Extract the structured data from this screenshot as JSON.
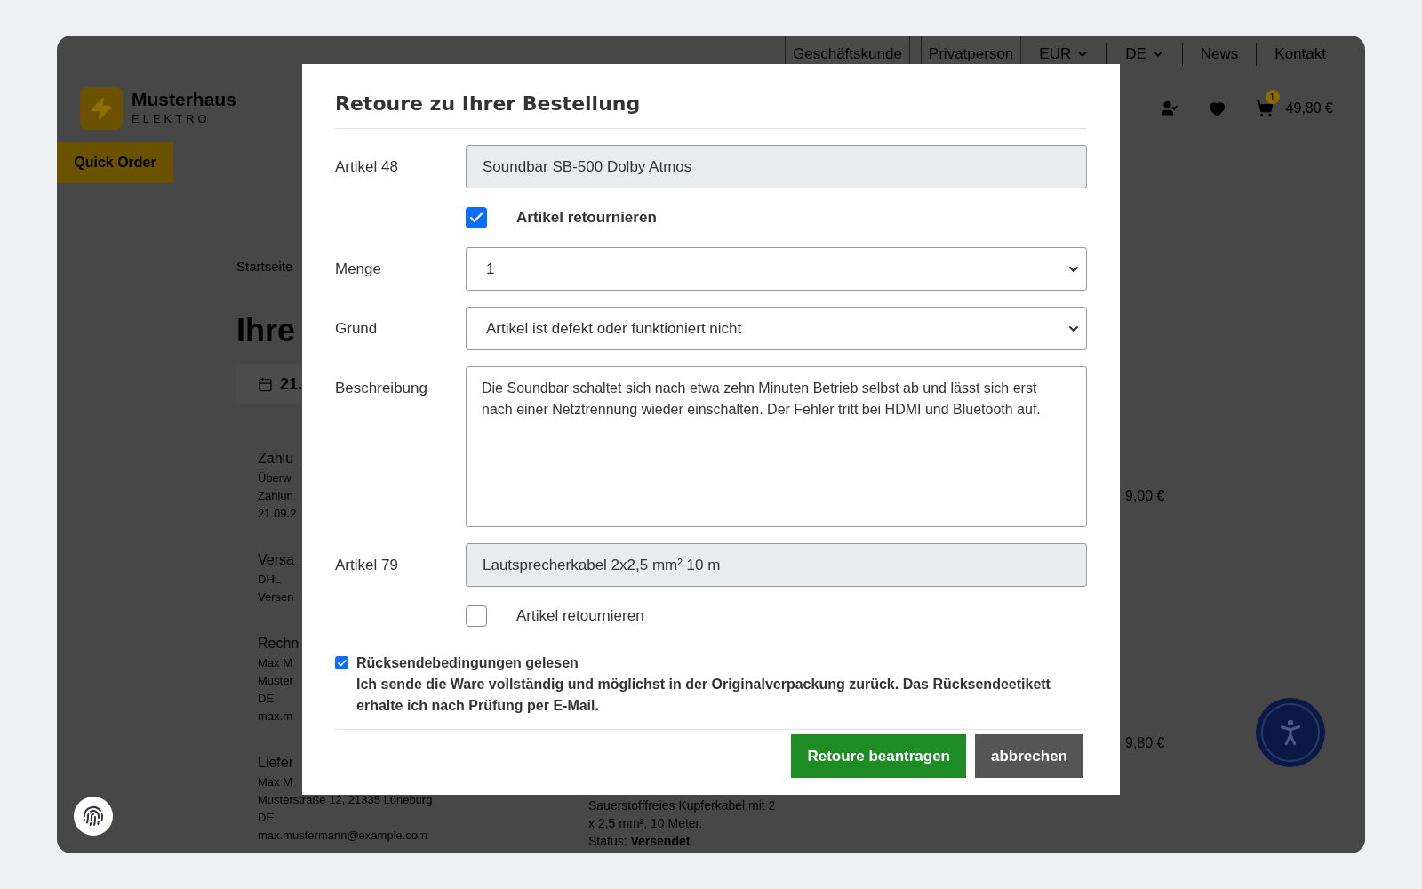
{
  "top_bar": {
    "customer_types": [
      {
        "label": "Geschäftskunde"
      },
      {
        "label": "Privatperson"
      }
    ],
    "currency": "EUR",
    "language": "DE",
    "links": [
      "News",
      "Kontakt"
    ]
  },
  "header": {
    "logo": {
      "name": "Musterhaus",
      "tagline": "ELEKTRO"
    },
    "cart": {
      "badge": "1",
      "total": "49,80 €"
    }
  },
  "quick_order": "Quick Order",
  "breadcrumb": [
    "Startseite"
  ],
  "heading": "Ihre",
  "order_date": "21.",
  "sections": [
    {
      "title": "Zahlu",
      "lines": [
        "Überw",
        "Zahlun",
        "21.09.2"
      ]
    },
    {
      "title": "Versa",
      "lines": [
        "DHL",
        "Versen"
      ]
    },
    {
      "title": "Rechn",
      "lines": [
        "Max M",
        "Muster",
        "DE",
        "max.m"
      ]
    },
    {
      "title": "Liefer",
      "lines": [
        "Max M",
        "Musterstraße 12, 21335 Lüneburg",
        "DE",
        "max.mustermann@example.com"
      ]
    }
  ],
  "prices": [
    "9,00 €",
    "9,80 €"
  ],
  "item_description": {
    "lines": [
      "Sauerstofffreies Kupferkabel mit 2",
      "x 2,5 mm², 10 Meter."
    ],
    "status_label": "Status:",
    "status": "Versendet"
  },
  "modal": {
    "title": "Retoure zu Ihrer Bestellung",
    "fields": [
      {
        "kind": "readonly",
        "label": "Artikel 48",
        "value": "Soundbar SB-500 Dolby Atmos"
      },
      {
        "kind": "checkbox",
        "label": "Artikel retournieren",
        "checked": true
      },
      {
        "kind": "select",
        "label": "Menge",
        "value": "1"
      },
      {
        "kind": "select",
        "label": "Grund",
        "value": "Artikel ist defekt oder funktioniert nicht"
      },
      {
        "kind": "textarea",
        "label": "Beschreibung",
        "value": "Die Soundbar schaltet sich nach etwa zehn Minuten Betrieb selbst ab und lässt sich erst nach einer Netztrennung wieder einschalten. Der Fehler tritt bei HDMI und Bluetooth auf."
      },
      {
        "kind": "readonly",
        "label": "Artikel 79",
        "value": "Lautsprecherkabel 2x2,5 mm² 10 m"
      },
      {
        "kind": "checkbox",
        "label": "Artikel retournieren",
        "checked": false
      }
    ],
    "terms": {
      "label": "Rücksendebedingungen gelesen",
      "checked": true,
      "text": "Ich sende die Ware vollständig und möglichst in der Originalverpackung zurück. Das Rücksendeetikett erhalte ich nach Prüfung per E-Mail."
    },
    "buttons": [
      {
        "kind": "primary",
        "label": "Retoure beantragen"
      },
      {
        "kind": "secondary",
        "label": "abbrechen"
      }
    ]
  }
}
